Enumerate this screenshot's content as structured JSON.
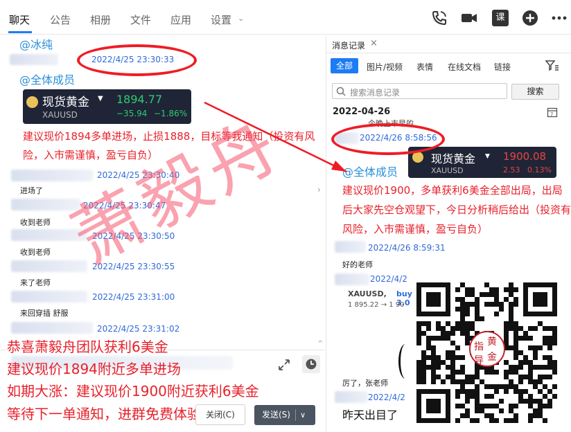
{
  "tabs": [
    "聊天",
    "公告",
    "相册",
    "文件",
    "应用",
    "设置"
  ],
  "right_top_label": "课",
  "chat": {
    "mention1": "@冰纯",
    "ts1": "2022/4/25 23:30:33",
    "mention2": "@全体成员",
    "card1": {
      "name": "现货黄金",
      "symbol": "XAUUSD",
      "price": "1894.77",
      "change": "−35.94",
      "pct": "−1.86%"
    },
    "advice1": "建议现价1894多单进场，止损1888，目标等我通知（投资有风险，入市需谨慎，盈亏自负）",
    "messages": [
      {
        "ts": "2022/4/25 23:30:40",
        "text": "进场了"
      },
      {
        "ts": "2022/4/25 23:30:47",
        "text": "收到老师"
      },
      {
        "ts": "2022/4/25 23:30:50",
        "text": "收到老师"
      },
      {
        "ts": "2022/4/25 23:30:55",
        "text": "来了老师"
      },
      {
        "ts": "2022/4/25 23:31:00",
        "text": "来回穿插  舒服"
      },
      {
        "ts": "2022/4/25 23:31:02",
        "text": ""
      }
    ]
  },
  "promo": {
    "line1": "恭喜萧毅舟团队获利6美金",
    "line2": "建议现价1894附近多单进场",
    "line3": "如期大涨：建议现价1900附近获利6美金",
    "line4": "等待下一单通知，进群免费体验"
  },
  "composer": {
    "close_label": "关闭(C)",
    "send_label": "发送(S)"
  },
  "watermark": "萧毅舟",
  "right": {
    "tab_title": "消息记录",
    "filters": [
      "全部",
      "图片/视频",
      "表情",
      "在线文档",
      "链接"
    ],
    "search_placeholder": "搜索消息记录",
    "search_button": "搜索",
    "date": "2022-04-26",
    "partial_top": "今晚上市早的",
    "ts1": "2022/4/26 8:58:56",
    "mention": "@全体成员",
    "card2": {
      "name": "现货黄金",
      "symbol": "XAUUSD",
      "price": "1900.08",
      "change": "2.53",
      "pct": "0.13%"
    },
    "advice2": "建议现价1900，多单获利6美金全部出局，出局后大家先空仓观望下，今日分析稍后给出（投资有风险，入市需谨慎，盈亏自负）",
    "ts2": "2022/4/26 8:59:31",
    "msg2": "好的老师",
    "ts3": "2022/4/2",
    "quote_sym": "XAUUSD,",
    "quote_buy": "buy 3.0",
    "quote_prices": "1 895.22 → 1 90",
    "msg3": "厉了，张老师",
    "ts4": "2022/4/2",
    "partial_bottom": "昨天出目了"
  },
  "qr": {
    "l1": "黄",
    "l2": "指",
    "l3": "金",
    "l4": "导"
  },
  "colors": {
    "accent": "#1c7cf4",
    "red": "#e8202a",
    "link": "#2f6ad8",
    "card_bg": "#1f2536",
    "gain": "#2ecc71",
    "loss": "#e84545"
  }
}
